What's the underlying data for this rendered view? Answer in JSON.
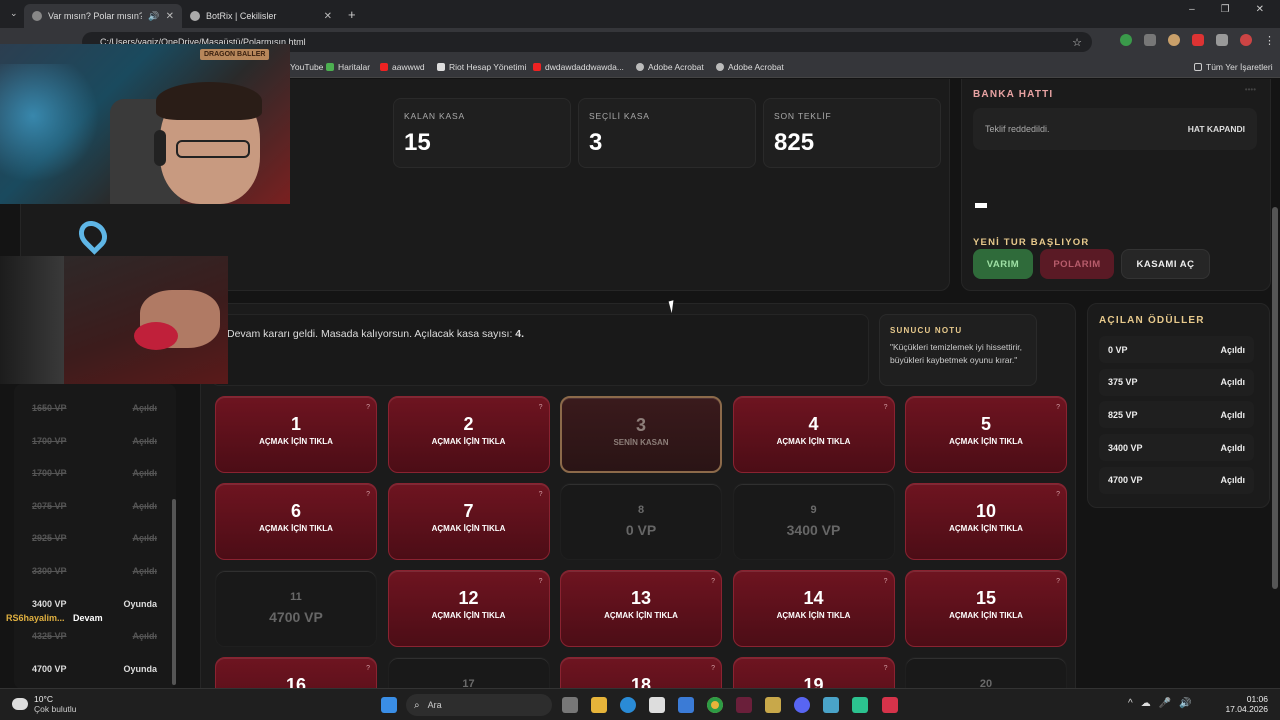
{
  "browser": {
    "tabs": [
      {
        "title": "Var mısın? Polar mısın?",
        "active": true
      },
      {
        "title": "BotRix | Cekilisler",
        "active": false
      }
    ],
    "new_tab": "+",
    "url": "C:/Users/yagiz/OneDrive/Masaüstü/Polarmısın.html",
    "bookmarks": [
      "YouTube",
      "Haritalar",
      "aawwwd",
      "Riot Hesap Yönetimi",
      "dwdawdaddwawda...",
      "Adobe Acrobat",
      "Adobe Acrobat"
    ],
    "all_bookmarks": "Tüm Yer İşaretleri",
    "window_controls": [
      "–",
      "❐",
      "✕"
    ]
  },
  "stats": [
    {
      "label": "KALAN KASA",
      "value": "15"
    },
    {
      "label": "SEÇİLİ KASA",
      "value": "3"
    },
    {
      "label": "SON TEKLİF",
      "value": "825"
    }
  ],
  "bank": {
    "title": "BANKA HATTI",
    "dots": "••••",
    "message": "Teklif reddedildi.",
    "status": "HAT KAPANDI",
    "new_round": "YENİ TUR BAŞLIYOR",
    "buttons": {
      "varim": "VARIM",
      "polarim": "POLARIM",
      "open": "KASAMI AÇ"
    }
  },
  "log_message": {
    "text": "Devam kararı geldi. Masada kalıyorsun. Açılacak kasa sayısı: ",
    "count": "4."
  },
  "host_note": {
    "title": "SUNUCU NOTU",
    "text": "\"Küçükleri temizlemek iyi hissettirir, büyükleri kaybetmek oyunu kırar.\""
  },
  "boxes": [
    {
      "n": "1",
      "state": "closed"
    },
    {
      "n": "2",
      "state": "closed"
    },
    {
      "n": "3",
      "state": "selected"
    },
    {
      "n": "4",
      "state": "closed"
    },
    {
      "n": "5",
      "state": "closed"
    },
    {
      "n": "6",
      "state": "closed"
    },
    {
      "n": "7",
      "state": "closed"
    },
    {
      "n": "8",
      "state": "open",
      "value": "0 VP"
    },
    {
      "n": "9",
      "state": "open",
      "value": "3400 VP"
    },
    {
      "n": "10",
      "state": "closed"
    },
    {
      "n": "11",
      "state": "open",
      "value": "4700 VP"
    },
    {
      "n": "12",
      "state": "closed"
    },
    {
      "n": "13",
      "state": "closed"
    },
    {
      "n": "14",
      "state": "closed"
    },
    {
      "n": "15",
      "state": "closed"
    },
    {
      "n": "16",
      "state": "closed"
    },
    {
      "n": "17",
      "state": "open",
      "value": ""
    },
    {
      "n": "18",
      "state": "closed"
    },
    {
      "n": "19",
      "state": "closed"
    },
    {
      "n": "20",
      "state": "open",
      "value": ""
    }
  ],
  "box_labels": {
    "closed": "AÇMAK İÇİN TIKLA",
    "selected": "SENİN KASAN",
    "hint": "?"
  },
  "opened_prizes": {
    "title": "AÇILAN ÖDÜLLER",
    "items": [
      {
        "value": "0 VP",
        "status": "Açıldı"
      },
      {
        "value": "375 VP",
        "status": "Açıldı"
      },
      {
        "value": "825 VP",
        "status": "Açıldı"
      },
      {
        "value": "3400 VP",
        "status": "Açıldı"
      },
      {
        "value": "4700 VP",
        "status": "Açıldı"
      }
    ]
  },
  "left_list": [
    {
      "value": "1650 VP",
      "status": "Açıldı",
      "live": false
    },
    {
      "value": "1700 VP",
      "status": "Açıldı",
      "live": false
    },
    {
      "value": "1700 VP",
      "status": "Açıldı",
      "live": false
    },
    {
      "value": "2075 VP",
      "status": "Açıldı",
      "live": false
    },
    {
      "value": "2925 VP",
      "status": "Açıldı",
      "live": false
    },
    {
      "value": "3300 VP",
      "status": "Açıldı",
      "live": false
    },
    {
      "value": "3400 VP",
      "status": "Oyunda",
      "live": true
    },
    {
      "value": "4325 VP",
      "status": "Açıldı",
      "live": false
    },
    {
      "value": "4700 VP",
      "status": "Oyunda",
      "live": true
    }
  ],
  "chat": {
    "user": "RS6hayalim...",
    "msg": "Devam"
  },
  "overlay": {
    "sign": "DRAGON BALLER"
  },
  "taskbar": {
    "weather_temp": "10°C",
    "weather_desc": "Çok bulutlu",
    "search": "Ara",
    "time": "01:06",
    "date": "17.04.2026"
  },
  "colors": {
    "accent": "#e8a3a3",
    "box_red": "#6e1420",
    "green": "#2f6b3a",
    "pink": "#5a1a25"
  }
}
